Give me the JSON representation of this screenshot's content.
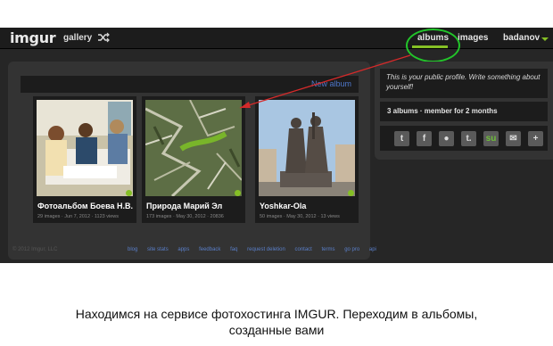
{
  "header": {
    "logo": "imgur",
    "gallery": "gallery",
    "albums": "albums",
    "images": "images",
    "user": "badanov"
  },
  "albums_panel": {
    "new_album": "New album",
    "albums": [
      {
        "title": "Фотоальбом Боева Н.В.",
        "meta": "29 images · Jun 7, 2012 · 1123 views"
      },
      {
        "title": "Природа Марий Эл",
        "meta": "173 images · May 30, 2012 · 20836"
      },
      {
        "title": "Yoshkar-Ola",
        "meta": "50 images · May 30, 2012 · 13 views"
      }
    ]
  },
  "footer": {
    "copyright": "© 2012 Imgur, LLC",
    "links": [
      "blog",
      "site stats",
      "apps",
      "feedback",
      "faq",
      "request deletion",
      "contact",
      "terms",
      "go pro",
      "api"
    ]
  },
  "profile": {
    "bio": "This is your public profile. Write something about yourself!",
    "stats": "3 albums · member for 2 months",
    "share_icons": [
      "twitter-icon",
      "facebook-icon",
      "reddit-icon",
      "tumblr-icon",
      "stumbleupon-icon",
      "email-icon",
      "plus-icon"
    ]
  },
  "colors": {
    "accent_green": "#85bf25",
    "highlight_circle": "#22c52a",
    "arrow": "#d42a2a",
    "link_blue": "#4e76c9"
  },
  "caption": {
    "line1": "Находимся на сервисе фотохостинга IMGUR. Переходим в альбомы,",
    "line2": "созданные вами"
  }
}
